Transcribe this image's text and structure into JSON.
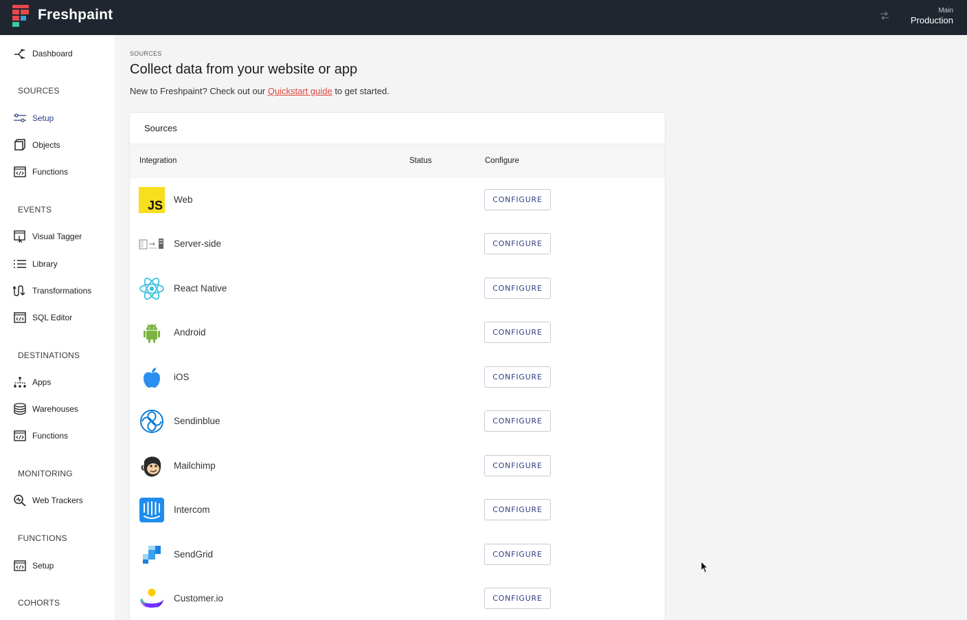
{
  "app": {
    "brand": "Freshpaint",
    "environment_label": "Main",
    "environment_value": "Production"
  },
  "sidebar": {
    "dashboard": "Dashboard",
    "sections": [
      {
        "title": "SOURCES",
        "items": [
          "Setup",
          "Objects",
          "Functions"
        ]
      },
      {
        "title": "EVENTS",
        "items": [
          "Visual Tagger",
          "Library",
          "Transformations",
          "SQL Editor"
        ]
      },
      {
        "title": "DESTINATIONS",
        "items": [
          "Apps",
          "Warehouses",
          "Functions"
        ]
      },
      {
        "title": "MONITORING",
        "items": [
          "Web Trackers"
        ]
      },
      {
        "title": "FUNCTIONS",
        "items": [
          "Setup"
        ]
      },
      {
        "title": "COHORTS",
        "items": []
      }
    ],
    "active_item": "Setup"
  },
  "page": {
    "eyebrow": "SOURCES",
    "title": "Collect data from your website or app",
    "intro_before": "New to Freshpaint? Check out our ",
    "intro_link": "Quickstart guide",
    "intro_after": " to get started."
  },
  "sources_card": {
    "title": "Sources",
    "columns": [
      "Integration",
      "Status",
      "Configure"
    ],
    "button_label": "CONFIGURE",
    "rows": [
      {
        "name": "Web",
        "icon": "javascript-icon"
      },
      {
        "name": "Server-side",
        "icon": "server-side-icon"
      },
      {
        "name": "React Native",
        "icon": "react-icon"
      },
      {
        "name": "Android",
        "icon": "android-icon"
      },
      {
        "name": "iOS",
        "icon": "apple-icon"
      },
      {
        "name": "Sendinblue",
        "icon": "sendinblue-icon"
      },
      {
        "name": "Mailchimp",
        "icon": "mailchimp-icon"
      },
      {
        "name": "Intercom",
        "icon": "intercom-icon"
      },
      {
        "name": "SendGrid",
        "icon": "sendgrid-icon"
      },
      {
        "name": "Customer.io",
        "icon": "customerio-icon"
      }
    ]
  },
  "colors": {
    "topbar": "#1f2630",
    "accent_navy": "#2f3d82",
    "link_red": "#e0473c",
    "sidebar_bg": "#ffffff",
    "page_bg": "#f4f4f5"
  }
}
